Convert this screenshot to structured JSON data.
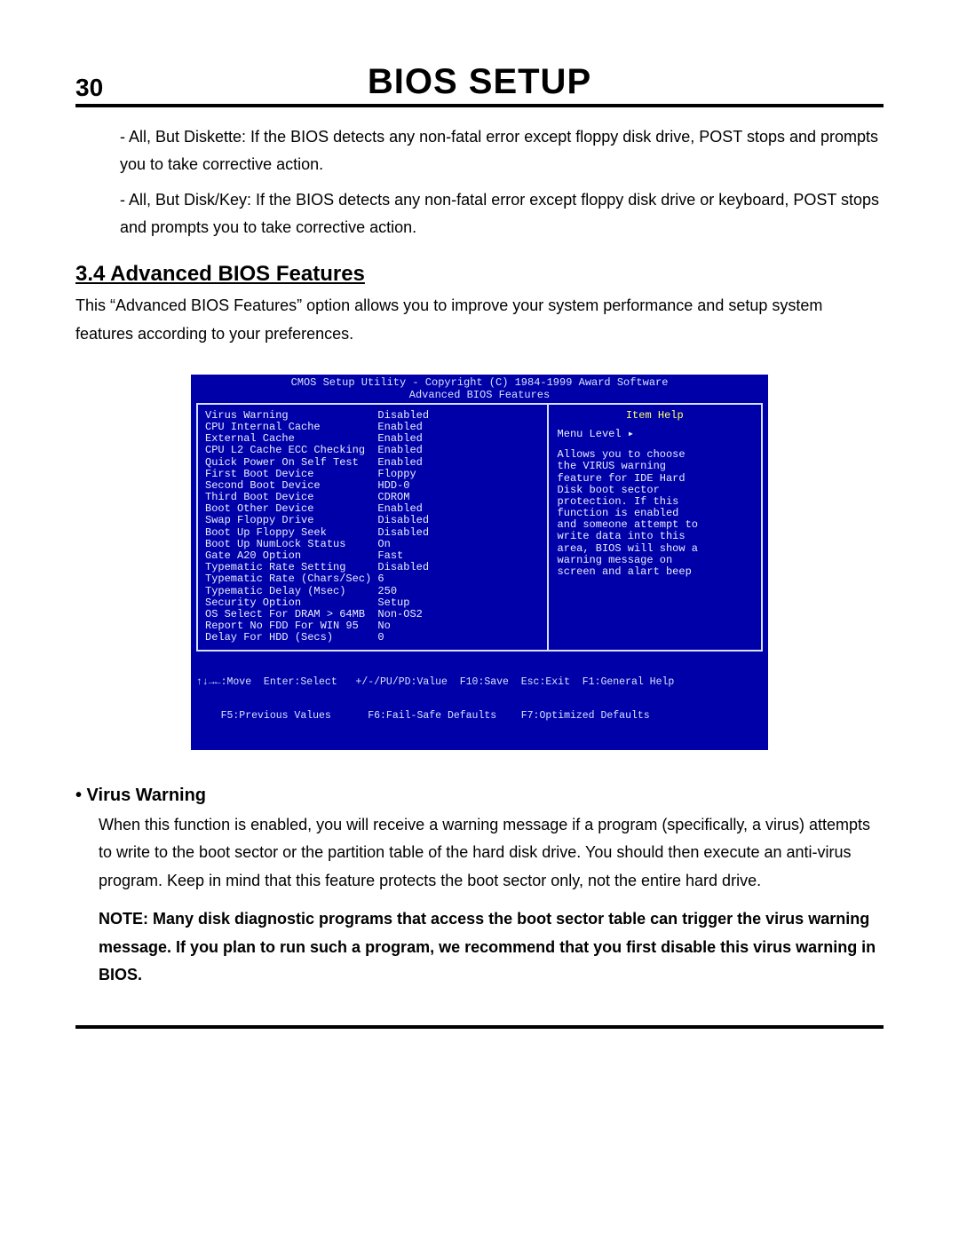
{
  "header": {
    "page_number": "30",
    "title": "BIOS SETUP"
  },
  "intro_bullets": [
    "- All, But Diskette:  If the BIOS detects any non-fatal error except floppy disk drive, POST stops and prompts you to take corrective action.",
    "- All, But Disk/Key:  If the BIOS detects any non-fatal error except floppy disk drive or keyboard, POST stops and prompts you to take corrective action."
  ],
  "section": {
    "heading": "3.4  Advanced BIOS Features",
    "intro": "This “Advanced BIOS Features” option allows you to improve your system performance and setup system features according to your preferences."
  },
  "bios": {
    "header_line1": "CMOS Setup Utility - Copyright (C) 1984-1999 Award Software",
    "header_line2": "Advanced BIOS Features",
    "options": [
      {
        "label": "Virus Warning",
        "value": "Disabled"
      },
      {
        "label": "CPU Internal Cache",
        "value": "Enabled"
      },
      {
        "label": "External Cache",
        "value": "Enabled"
      },
      {
        "label": "CPU L2 Cache ECC Checking",
        "value": "Enabled"
      },
      {
        "label": "Quick Power On Self Test",
        "value": "Enabled"
      },
      {
        "label": "First Boot Device",
        "value": "Floppy"
      },
      {
        "label": "Second Boot Device",
        "value": "HDD-0"
      },
      {
        "label": "Third Boot Device",
        "value": "CDROM"
      },
      {
        "label": "Boot Other Device",
        "value": "Enabled"
      },
      {
        "label": "Swap Floppy Drive",
        "value": "Disabled"
      },
      {
        "label": "Boot Up Floppy Seek",
        "value": "Disabled"
      },
      {
        "label": "Boot Up NumLock Status",
        "value": "On"
      },
      {
        "label": "Gate A20 Option",
        "value": "Fast"
      },
      {
        "label": "Typematic Rate Setting",
        "value": "Disabled"
      },
      {
        "label": "Typematic Rate (Chars/Sec)",
        "value": "6"
      },
      {
        "label": "Typematic Delay (Msec)",
        "value": "250"
      },
      {
        "label": "Security Option",
        "value": "Setup"
      },
      {
        "label": "OS Select For DRAM > 64MB",
        "value": "Non-OS2"
      },
      {
        "label": "Report No FDD For WIN 95",
        "value": "No"
      },
      {
        "label": "Delay For HDD (Secs)",
        "value": "0"
      }
    ],
    "help_title": "Item Help",
    "menu_level": "Menu Level  ▸",
    "help_text": [
      "Allows you to choose",
      "the VIRUS warning",
      "feature for IDE Hard",
      "Disk boot sector",
      "protection. If this",
      "function is enabled",
      "and someone attempt to",
      "write data into this",
      "area, BIOS will show a",
      "warning message on",
      "screen and alart beep"
    ],
    "footer_line1": "↑↓→←:Move  Enter:Select   +/-/PU/PD:Value  F10:Save  Esc:Exit  F1:General Help",
    "footer_line2": "    F5:Previous Values      F6:Fail-Safe Defaults    F7:Optimized Defaults"
  },
  "virus": {
    "heading": "• Virus Warning",
    "body": "When this  function is enabled, you will receive a warning message if a program (specifically, a virus) attempts to write to the boot sector or the partition table of the hard disk drive.  You should then execute an anti-virus program.  Keep in mind that this feature protects the boot sector only, not the entire hard drive.",
    "note": "NOTE:  Many disk diagnostic programs that access the boot sector table can trigger the virus warning message.  If you plan to run such a program, we recommend that you first disable this virus warning in BIOS."
  }
}
